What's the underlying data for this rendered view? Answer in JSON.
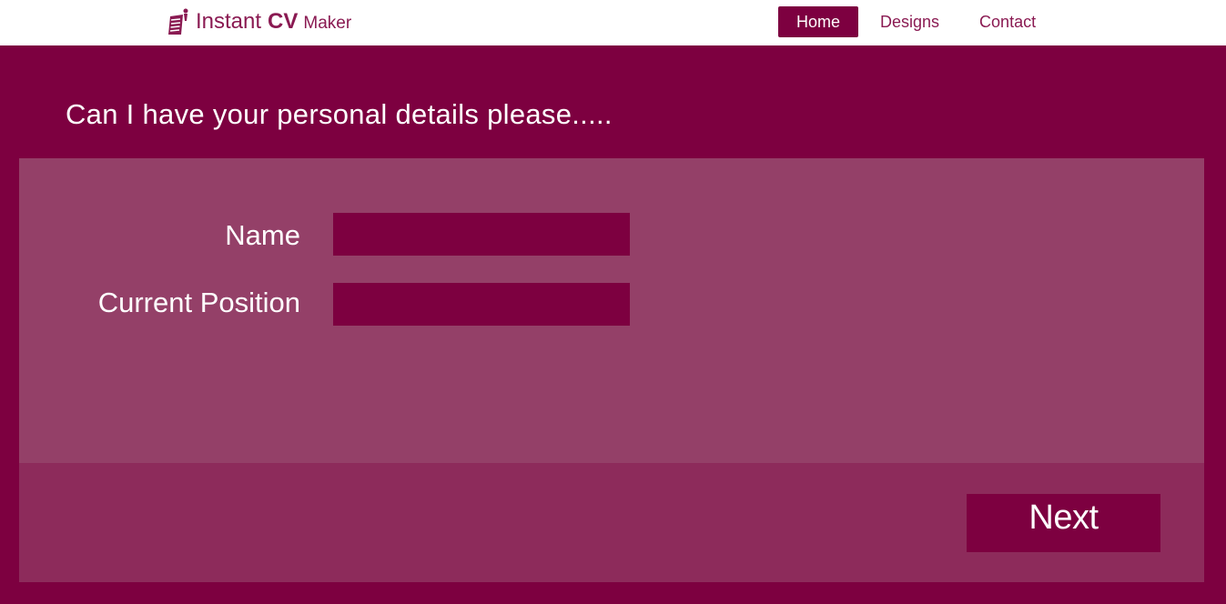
{
  "header": {
    "brand": {
      "part1": "Instant",
      "part2": "CV",
      "part3": "Maker",
      "icon": "document-person-icon"
    },
    "nav": [
      {
        "label": "Home",
        "active": true
      },
      {
        "label": "Designs",
        "active": false
      },
      {
        "label": "Contact",
        "active": false
      }
    ]
  },
  "main": {
    "heading": "Can I have your personal details please.....",
    "fields": [
      {
        "label": "Name",
        "value": "",
        "placeholder": ""
      },
      {
        "label": "Current Position",
        "value": "",
        "placeholder": ""
      }
    ],
    "next_label": "Next"
  },
  "colors": {
    "primary": "#7d0040",
    "panel": "#944068",
    "footer_panel": "#8d2b5b",
    "text_on_primary": "#ffffff"
  }
}
